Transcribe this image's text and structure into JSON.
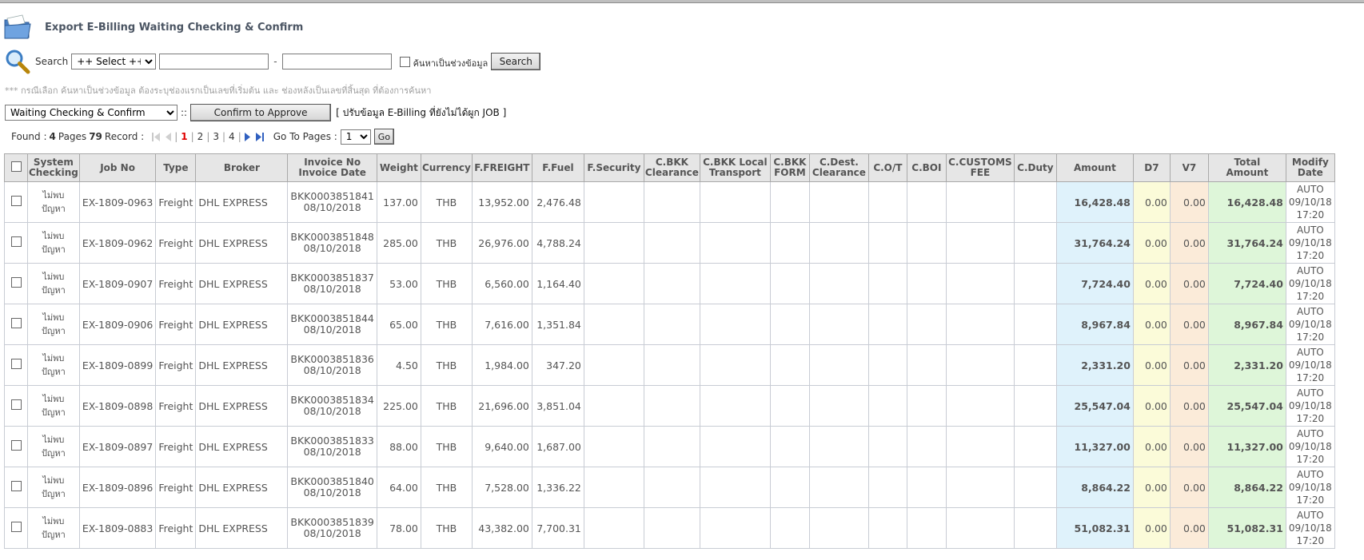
{
  "header": {
    "title": "Export E-Billing Waiting Checking & Confirm"
  },
  "search": {
    "label": "Search",
    "select_value": "++ Select ++",
    "range_separator": "-",
    "range_checkbox_label": "ค้นหาเป็นช่วงข้อมูล",
    "button_label": "Search"
  },
  "note": "*** กรณีเลือก ค้นหาเป็นช่วงข้อมูล ต้องระบุช่องแรกเป็นเลขที่เริ่มต้น และ ช่องหลังเป็นเลขที่สิ้นสุด ที่ต้องการค้นหา",
  "actions": {
    "status_select_value": "Waiting Checking & Confirm",
    "separator": "::",
    "confirm_button_label": "Confirm to Approve",
    "adjust_link": "[ ปรับข้อมูล E-Billing ที่ยังไม่ได้ผูก JOB ]"
  },
  "pager": {
    "found_label": "Found :",
    "pages_count": "4",
    "pages_label": "Pages",
    "records_count": "79",
    "records_label": "Record :",
    "pages": [
      "1",
      "2",
      "3",
      "4"
    ],
    "current_page": "1",
    "goto_label": "Go To Pages :",
    "goto_value": "1",
    "go_label": "Go"
  },
  "table": {
    "columns": [
      "System Checking",
      "Job No",
      "Type",
      "Broker",
      "Invoice No Invoice Date",
      "Weight",
      "Currency",
      "F.FREIGHT",
      "F.Fuel",
      "F.Security",
      "C.BKK Clearance",
      "C.BKK Local Transport",
      "C.BKK FORM",
      "C.Dest. Clearance",
      "C.O/T",
      "C.BOI",
      "C.CUSTOMS FEE",
      "C.Duty",
      "Amount",
      "D7",
      "V7",
      "Total Amount",
      "Modify Date"
    ],
    "header_lines": {
      "system_checking": [
        "System",
        "Checking"
      ],
      "invoice": [
        "Invoice No",
        "Invoice Date"
      ],
      "c_bkk_clearance": [
        "C.BKK",
        "Clearance"
      ],
      "c_bkk_local": [
        "C.BKK Local",
        "Transport"
      ],
      "c_bkk_form": [
        "C.BKK",
        "FORM"
      ],
      "c_dest": [
        "C.Dest.",
        "Clearance"
      ],
      "c_customs": [
        "C.CUSTOMS",
        "FEE"
      ],
      "total_amount": [
        "Total",
        "Amount"
      ],
      "modify_date": [
        "Modify",
        "Date"
      ]
    },
    "rows": [
      {
        "status": [
          "ไม่พบ",
          "ปัญหา"
        ],
        "job_no": "EX-1809-0963",
        "type": "Freight",
        "broker": "DHL EXPRESS",
        "invoice_no": "BKK0003851841",
        "invoice_date": "08/10/2018",
        "weight": "137.00",
        "currency": "THB",
        "freight": "13,952.00",
        "fuel": "2,476.48",
        "amount": "16,428.48",
        "d7": "0.00",
        "v7": "0.00",
        "total": "16,428.48",
        "modify": [
          "AUTO",
          "09/10/18",
          "17:20"
        ]
      },
      {
        "status": [
          "ไม่พบ",
          "ปัญหา"
        ],
        "job_no": "EX-1809-0962",
        "type": "Freight",
        "broker": "DHL EXPRESS",
        "invoice_no": "BKK0003851848",
        "invoice_date": "08/10/2018",
        "weight": "285.00",
        "currency": "THB",
        "freight": "26,976.00",
        "fuel": "4,788.24",
        "amount": "31,764.24",
        "d7": "0.00",
        "v7": "0.00",
        "total": "31,764.24",
        "modify": [
          "AUTO",
          "09/10/18",
          "17:20"
        ]
      },
      {
        "status": [
          "ไม่พบ",
          "ปัญหา"
        ],
        "job_no": "EX-1809-0907",
        "type": "Freight",
        "broker": "DHL EXPRESS",
        "invoice_no": "BKK0003851837",
        "invoice_date": "08/10/2018",
        "weight": "53.00",
        "currency": "THB",
        "freight": "6,560.00",
        "fuel": "1,164.40",
        "amount": "7,724.40",
        "d7": "0.00",
        "v7": "0.00",
        "total": "7,724.40",
        "modify": [
          "AUTO",
          "09/10/18",
          "17:20"
        ]
      },
      {
        "status": [
          "ไม่พบ",
          "ปัญหา"
        ],
        "job_no": "EX-1809-0906",
        "type": "Freight",
        "broker": "DHL EXPRESS",
        "invoice_no": "BKK0003851844",
        "invoice_date": "08/10/2018",
        "weight": "65.00",
        "currency": "THB",
        "freight": "7,616.00",
        "fuel": "1,351.84",
        "amount": "8,967.84",
        "d7": "0.00",
        "v7": "0.00",
        "total": "8,967.84",
        "modify": [
          "AUTO",
          "09/10/18",
          "17:20"
        ]
      },
      {
        "status": [
          "ไม่พบ",
          "ปัญหา"
        ],
        "job_no": "EX-1809-0899",
        "type": "Freight",
        "broker": "DHL EXPRESS",
        "invoice_no": "BKK0003851836",
        "invoice_date": "08/10/2018",
        "weight": "4.50",
        "currency": "THB",
        "freight": "1,984.00",
        "fuel": "347.20",
        "amount": "2,331.20",
        "d7": "0.00",
        "v7": "0.00",
        "total": "2,331.20",
        "modify": [
          "AUTO",
          "09/10/18",
          "17:20"
        ]
      },
      {
        "status": [
          "ไม่พบ",
          "ปัญหา"
        ],
        "job_no": "EX-1809-0898",
        "type": "Freight",
        "broker": "DHL EXPRESS",
        "invoice_no": "BKK0003851834",
        "invoice_date": "08/10/2018",
        "weight": "225.00",
        "currency": "THB",
        "freight": "21,696.00",
        "fuel": "3,851.04",
        "amount": "25,547.04",
        "d7": "0.00",
        "v7": "0.00",
        "total": "25,547.04",
        "modify": [
          "AUTO",
          "09/10/18",
          "17:20"
        ]
      },
      {
        "status": [
          "ไม่พบ",
          "ปัญหา"
        ],
        "job_no": "EX-1809-0897",
        "type": "Freight",
        "broker": "DHL EXPRESS",
        "invoice_no": "BKK0003851833",
        "invoice_date": "08/10/2018",
        "weight": "88.00",
        "currency": "THB",
        "freight": "9,640.00",
        "fuel": "1,687.00",
        "amount": "11,327.00",
        "d7": "0.00",
        "v7": "0.00",
        "total": "11,327.00",
        "modify": [
          "AUTO",
          "09/10/18",
          "17:20"
        ]
      },
      {
        "status": [
          "ไม่พบ",
          "ปัญหา"
        ],
        "job_no": "EX-1809-0896",
        "type": "Freight",
        "broker": "DHL EXPRESS",
        "invoice_no": "BKK0003851840",
        "invoice_date": "08/10/2018",
        "weight": "64.00",
        "currency": "THB",
        "freight": "7,528.00",
        "fuel": "1,336.22",
        "amount": "8,864.22",
        "d7": "0.00",
        "v7": "0.00",
        "total": "8,864.22",
        "modify": [
          "AUTO",
          "09/10/18",
          "17:20"
        ]
      },
      {
        "status": [
          "ไม่พบ",
          "ปัญหา"
        ],
        "job_no": "EX-1809-0883",
        "type": "Freight",
        "broker": "DHL EXPRESS",
        "invoice_no": "BKK0003851839",
        "invoice_date": "08/10/2018",
        "weight": "78.00",
        "currency": "THB",
        "freight": "43,382.00",
        "fuel": "7,700.31",
        "amount": "51,082.31",
        "d7": "0.00",
        "v7": "0.00",
        "total": "51,082.31",
        "modify": [
          "AUTO",
          "09/10/18",
          "17:20"
        ]
      }
    ]
  },
  "icons": {
    "title": "folder-icon",
    "search": "magnifier-icon",
    "pager": [
      "first-page-icon",
      "prev-page-icon",
      "next-page-icon",
      "last-page-icon"
    ]
  },
  "colors": {
    "status_ok": "#33a020",
    "current_page": "#e00000",
    "amount_bg": "#dff2fb",
    "d7_bg": "#fbfbd9",
    "v7_bg": "#fbebd9",
    "total_bg": "#def6d9"
  }
}
